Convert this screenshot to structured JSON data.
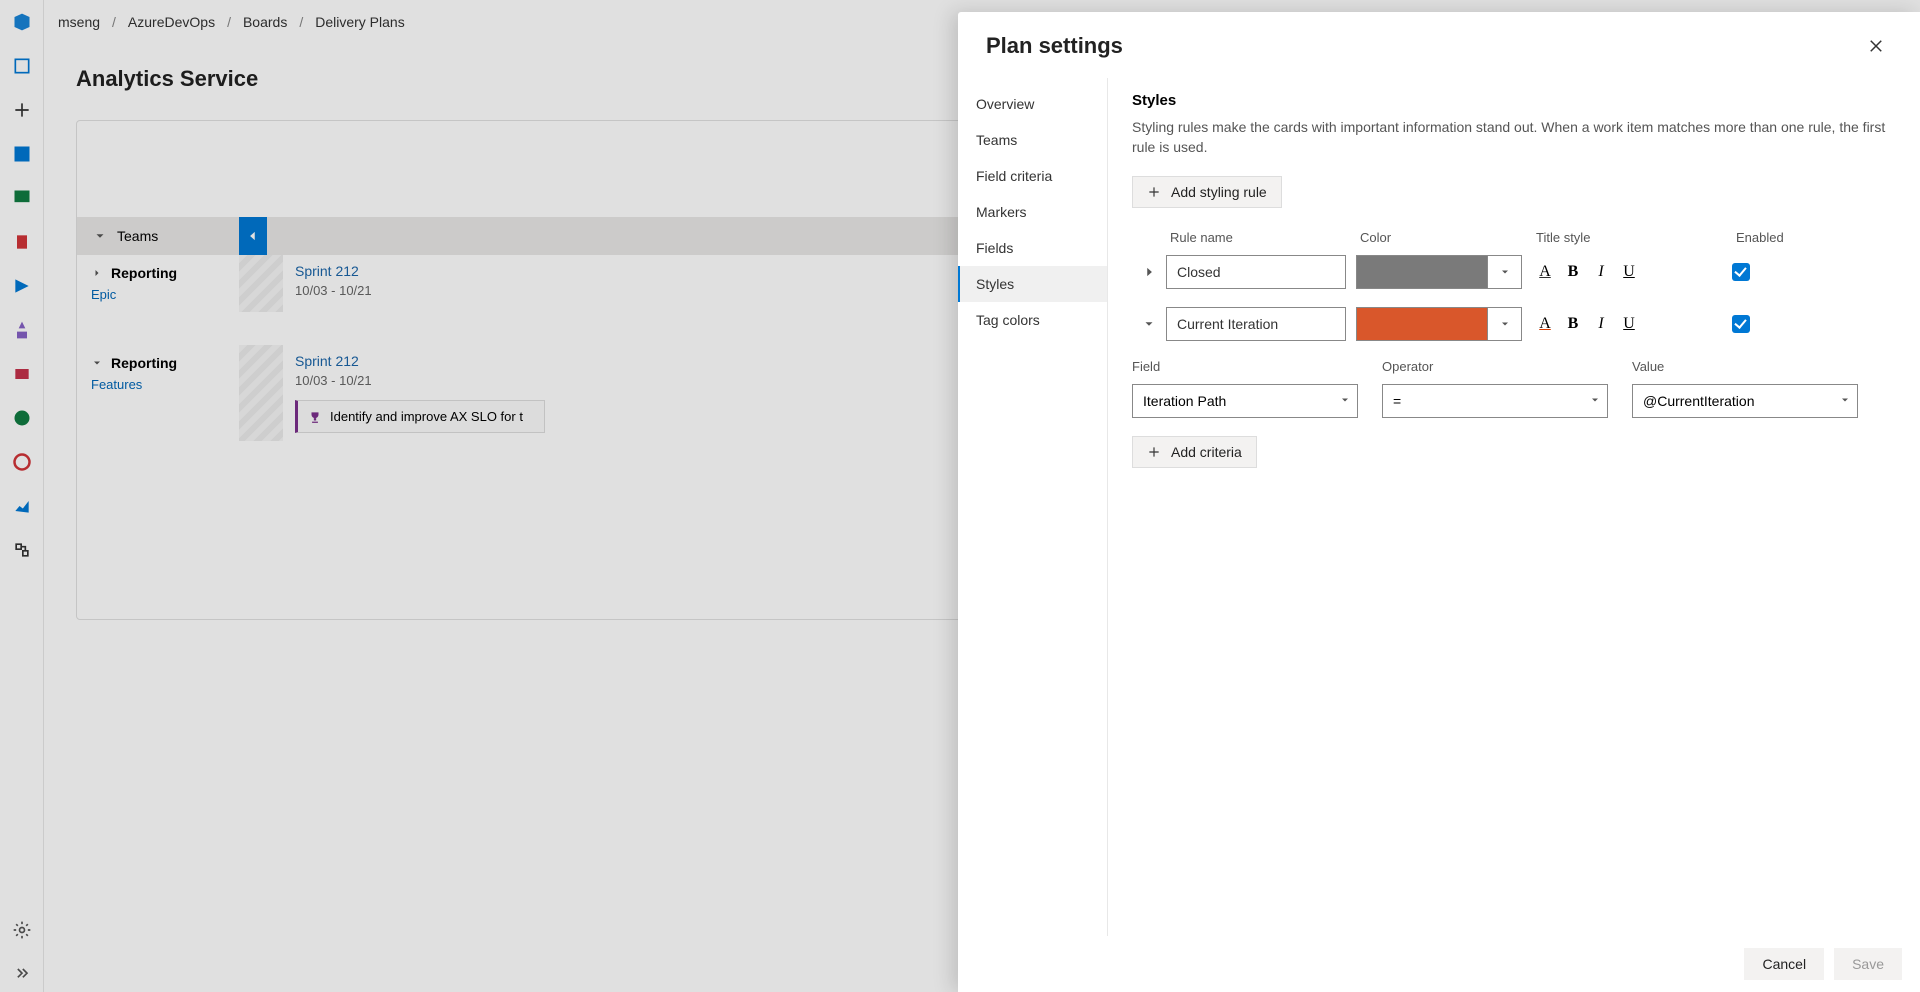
{
  "breadcrumbs": [
    "mseng",
    "AzureDevOps",
    "Boards",
    "Delivery Plans"
  ],
  "page_title": "Analytics Service",
  "team_band_label": "Teams",
  "teams": [
    {
      "name": "Reporting",
      "backlog": "Epic",
      "sprint": "Sprint 212",
      "dates": "10/03 - 10/21",
      "card": ""
    },
    {
      "name": "Reporting",
      "backlog": "Features",
      "sprint": "Sprint 212",
      "dates": "10/03 - 10/21",
      "card": "Identify and improve AX SLO for t"
    }
  ],
  "panel": {
    "title": "Plan settings",
    "nav": [
      "Overview",
      "Teams",
      "Field criteria",
      "Markers",
      "Fields",
      "Styles",
      "Tag colors"
    ],
    "active_nav": "Styles",
    "section_title": "Styles",
    "section_desc": "Styling rules make the cards with important information stand out. When a work item matches more than one rule, the first rule is used.",
    "add_rule_label": "Add styling rule",
    "columns": {
      "name": "Rule name",
      "color": "Color",
      "title_style": "Title style",
      "enabled": "Enabled"
    },
    "rules": [
      {
        "expanded": false,
        "name": "Closed",
        "color": "#7a7a7a",
        "title_deco": "std",
        "enabled": true
      },
      {
        "expanded": true,
        "name": "Current Iteration",
        "color": "#d9572b",
        "title_deco": "orange",
        "enabled": true
      }
    ],
    "criteria_columns": {
      "field": "Field",
      "operator": "Operator",
      "value": "Value"
    },
    "criteria": {
      "field": "Iteration Path",
      "operator": "=",
      "value": "@CurrentIteration"
    },
    "add_criteria_label": "Add criteria",
    "footer": {
      "cancel": "Cancel",
      "save": "Save"
    }
  },
  "glyphs": {
    "A": "A",
    "B": "B",
    "I": "I",
    "U": "U"
  }
}
